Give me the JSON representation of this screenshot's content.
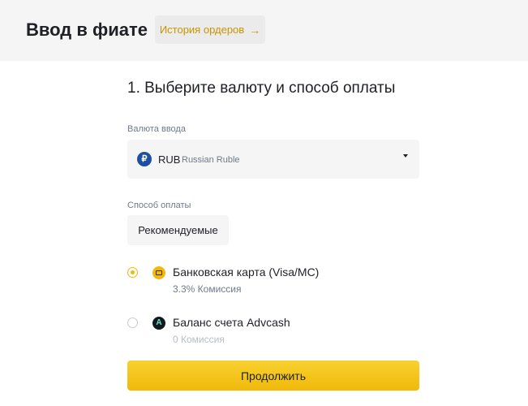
{
  "header": {
    "title": "Ввод в фиате",
    "history_button": "История ордеров",
    "history_arrow": "→"
  },
  "step": {
    "title": "1. Выберите валюту и способ оплаты"
  },
  "currency": {
    "label": "Валюта ввода",
    "icon_symbol": "₽",
    "icon": "ruble-icon",
    "code": "RUB",
    "name": "Russian Ruble",
    "dropdown_icon": "caret-down-icon"
  },
  "payment": {
    "label": "Способ оплаты",
    "tab_recommended": "Рекомендуемые",
    "methods": [
      {
        "name": "Банковская карта (Visa/MC)",
        "fee": "3.3% Комиссия",
        "selected": true,
        "icon": "bank-card-icon"
      },
      {
        "name": "Баланс счета Advcash",
        "fee": "0 Комиссия",
        "selected": false,
        "icon": "advcash-icon",
        "icon_letter": "A"
      }
    ]
  },
  "actions": {
    "continue": "Продолжить"
  },
  "colors": {
    "accent": "#f0b90b",
    "accent_text": "#c99400",
    "text_primary": "#1e2026",
    "text_secondary": "#707a8a",
    "field_bg": "#f5f5f5"
  }
}
